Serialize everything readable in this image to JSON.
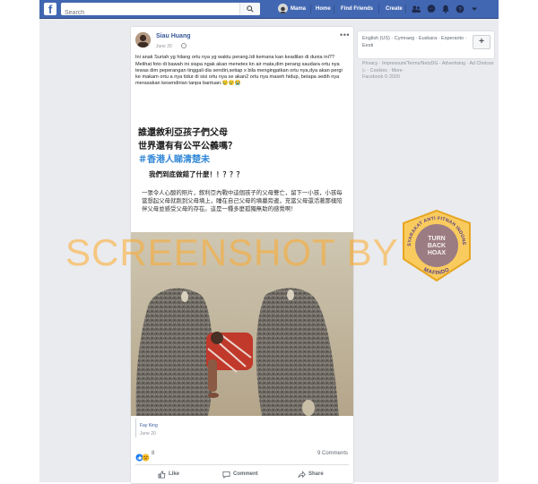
{
  "topbar": {
    "logo": "f",
    "search_placeholder": "Search",
    "profile_name": "Mama",
    "home_label": "Home",
    "find_friends_label": "Find Friends",
    "create_label": "Create"
  },
  "post": {
    "author": "Siau Huang",
    "date": "June 20",
    "text_lines": [
      "Ini anak Suriah yg hilang ortu nya yg waktu perang.Idi kemana kan keadilan di dunia ini??",
      "Melihat foto di bawah ini siapa ngak akan menetes kn air mata,dim perang saudara ortu nya tewas dim peperangan tinggali dia sendiri,setiap x bila mengingatkan ortu nya,dya akan pergi ke makam ortu a nya tidur di sisi ortu nya se akan2 ortu nya maseh hidup, betapa sedih nya merasakan kesendirian tanpa bantuan.😢😢😭"
    ],
    "image": {
      "title_line1": "誰還敘利亞孩子們父母",
      "title_line2": "世界還有有公平公義嗎？",
      "title_line3": "＃香港人睇清楚未",
      "question": "我們到底做錯了什麼！！？？？",
      "body": "一張令人心酸的照片，敘利亞內戰中這個孩子的父母雙亡，留下一小孩，小孩每當想起父母就跑到父母墳上，睡在自己父母的墳墓旁邊，充當父母還活著那樣陪伴父母並感受父母的存在。這是一種多麼孤獨無助的感覺啊！"
    },
    "shared_author": "Fay King",
    "shared_date": "June 20",
    "reaction_count": "8",
    "comments_count": "9 Comments",
    "actions": {
      "like": "Like",
      "comment": "Comment",
      "share": "Share"
    }
  },
  "watermark": {
    "text": "SCREENSHOT BY",
    "seal_top": "MASYARAKAT ANTI FITNAH INDONESIA",
    "seal_bottom": "MAFINDO",
    "seal_center": [
      "TURN",
      "BACK",
      "HOAX"
    ]
  },
  "sidebar": {
    "languages": "English (US) · Cymraeg · Euskara · Esperanto · Eesti",
    "plus": "+",
    "footer_links": "Privacy · Impressum/Terms/NetzDG · Advertising · Ad Choices ▷ · Cookies · More ·",
    "copyright": "Facebook © 2020"
  },
  "colors": {
    "brand": "#4267b2",
    "link": "#385898",
    "background": "#e9ebee",
    "watermark": "#ffaa28",
    "hashtag": "#2f86d6"
  }
}
